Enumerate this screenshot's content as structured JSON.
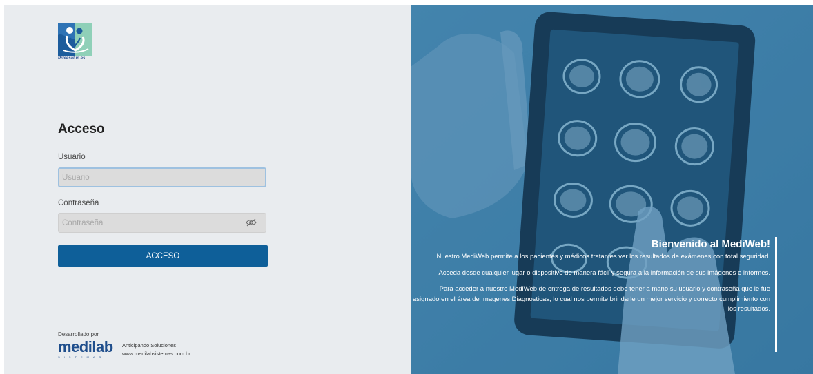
{
  "brand": {
    "logo_text": "Protesalud.es"
  },
  "login": {
    "title": "Acceso",
    "user_label": "Usuario",
    "user_placeholder": "Usuario",
    "password_label": "Contraseña",
    "password_placeholder": "Contraseña",
    "submit_label": "ACCESO"
  },
  "icons": {
    "password_toggle": "eye-icon"
  },
  "colors": {
    "primary": "#0e5f99",
    "panel_bg": "#e9ecef",
    "hero_tint": "#3d7fa8"
  },
  "footer": {
    "developed_by": "Desarrollado por",
    "company_name": "medilab",
    "company_sub": "SISTEMAS",
    "tagline": "Anticipando Soluciones",
    "website": "www.medilabsistemas.com.br"
  },
  "welcome": {
    "title": "Bienvenido al MediWeb!",
    "paragraphs": [
      "Nuestro MediWeb permite a los pacientes y médicos tratantes ver los resultados de exámenes con total seguridad.",
      "Acceda desde cualquier lugar o dispositivo de manera fácil y segura a la información de sus imágenes e informes.",
      "Para acceder a nuestro MediWeb de entrega de resultados debe tener a mano su usuario y contraseña que le fue asignado en el área de Imagenes Diagnosticas, lo cual nos permite brindarle un mejor servicio y correcto cumplimiento con los resultados."
    ]
  }
}
